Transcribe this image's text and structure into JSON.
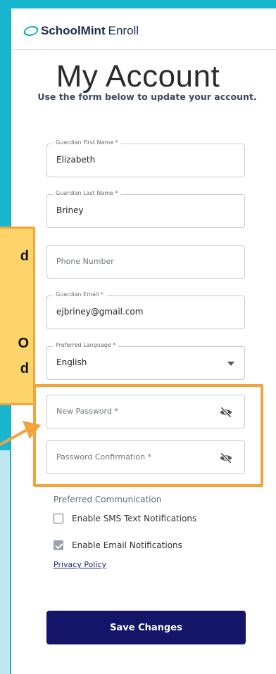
{
  "brand": {
    "name_bold": "SchoolMint",
    "name_light": "Enroll"
  },
  "page": {
    "title": "My Account",
    "subtitle": "Use the form below to update your account."
  },
  "form": {
    "first_name": {
      "legend": "Guardian First Name *",
      "value": "Elizabeth"
    },
    "last_name": {
      "legend": "Guardian Last Name *",
      "value": "Briney"
    },
    "phone": {
      "placeholder": "Phone Number"
    },
    "email": {
      "legend": "Guardian Email *",
      "value": "ejbriney@gmail.com"
    },
    "language": {
      "legend": "Preferred Language *",
      "value": "English"
    },
    "new_password": {
      "placeholder": "New Password *"
    },
    "password_confirm": {
      "placeholder": "Password Confirmation *"
    },
    "communication": {
      "label": "Preferred Communication",
      "sms": {
        "label": "Enable SMS Text Notifications",
        "checked": false
      },
      "email": {
        "label": "Enable Email Notifications",
        "checked": true
      }
    },
    "privacy_link": "Privacy Policy",
    "save_label": "Save Changes"
  },
  "callout": {
    "line1": "d",
    "line2": "O",
    "line3": "d"
  },
  "colors": {
    "accent_orange": "#f2a43d",
    "callout_yellow": "#fcd46a",
    "brand_navy": "#141468",
    "teal": "#19b6cf"
  }
}
